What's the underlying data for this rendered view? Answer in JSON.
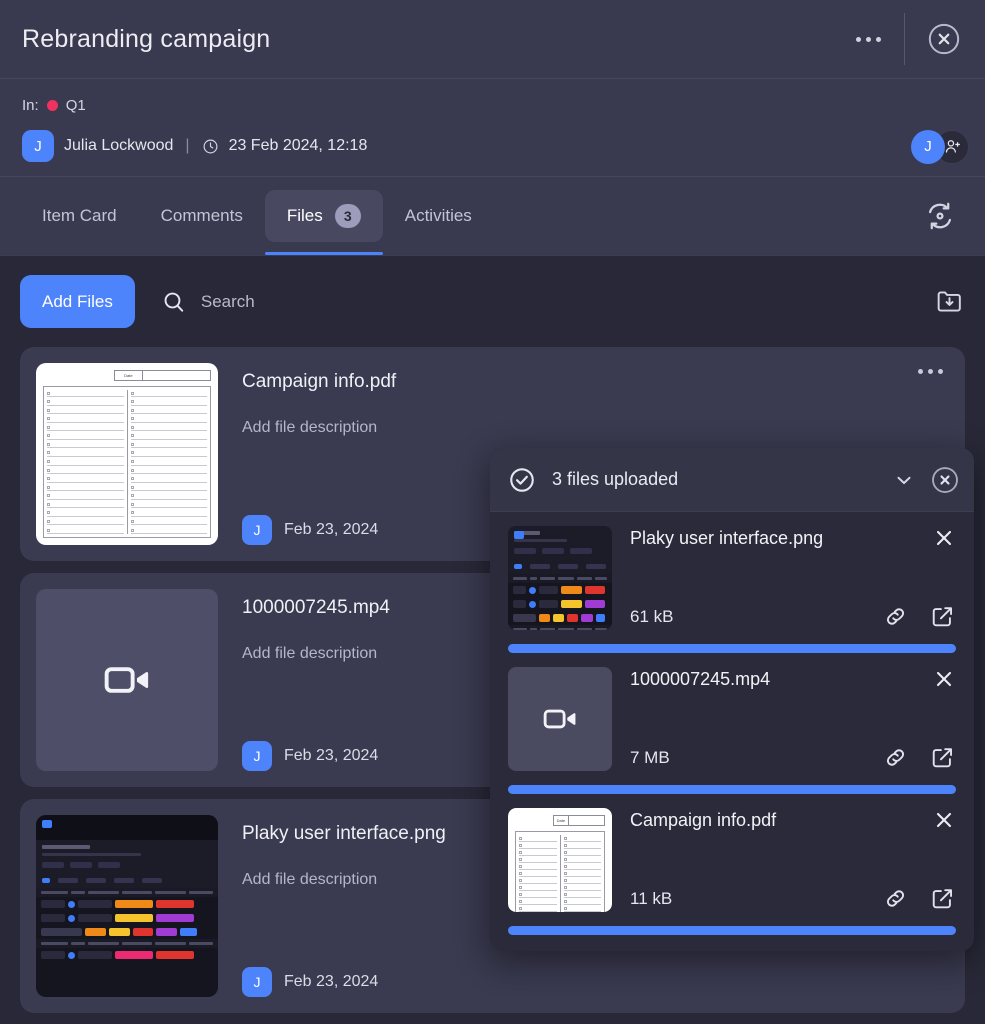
{
  "header": {
    "title": "Rebranding campaign",
    "kebab_icon": "more-horizontal-icon",
    "close_icon": "close-circle-icon"
  },
  "meta": {
    "in_label": "In:",
    "board": "Q1",
    "board_color": "#f0335e",
    "author_initial": "J",
    "author": "Julia Lockwood",
    "separator": "|",
    "clock_icon": "clock-icon",
    "datetime": "23 Feb 2024, 12:18",
    "avatar_initial": "J",
    "add_member_icon": "add-person-icon"
  },
  "tabs": [
    {
      "label": "Item Card",
      "active": false,
      "badge": null
    },
    {
      "label": "Comments",
      "active": false,
      "badge": null
    },
    {
      "label": "Files",
      "active": true,
      "badge": "3"
    },
    {
      "label": "Activities",
      "active": false,
      "badge": null
    }
  ],
  "tabbar": {
    "sync_icon": "sync-refresh-icon"
  },
  "toolbar": {
    "add_files_label": "Add Files",
    "search_icon": "search-icon",
    "search_placeholder": "Search",
    "search_value": "",
    "download_folder_icon": "folder-download-icon"
  },
  "files": [
    {
      "name": "Campaign info.pdf",
      "description": "Add file description",
      "avatar_initial": "J",
      "date": "Feb 23, 2024",
      "thumb_type": "pdf",
      "kebab_icon": "more-horizontal-icon"
    },
    {
      "name": "1000007245.mp4",
      "description": "Add file description",
      "avatar_initial": "J",
      "date": "Feb 23, 2024",
      "thumb_type": "video",
      "kebab_icon": "more-horizontal-icon"
    },
    {
      "name": "Plaky user interface.png",
      "description": "Add file description",
      "avatar_initial": "J",
      "date": "Feb 23, 2024",
      "thumb_type": "png",
      "kebab_icon": "more-horizontal-icon"
    }
  ],
  "toast": {
    "status_icon": "check-circle-icon",
    "title": "3 files uploaded",
    "collapse_icon": "chevron-down-icon",
    "close_icon": "close-circle-icon",
    "uploads": [
      {
        "name": "Plaky user interface.png",
        "size": "61 kB",
        "progress": 100,
        "thumb_type": "png",
        "remove_icon": "close-icon",
        "link_icon": "link-icon",
        "open_icon": "open-external-icon"
      },
      {
        "name": "1000007245.mp4",
        "size": "7 MB",
        "progress": 100,
        "thumb_type": "video",
        "remove_icon": "close-icon",
        "link_icon": "link-icon",
        "open_icon": "open-external-icon"
      },
      {
        "name": "Campaign info.pdf",
        "size": "11 kB",
        "progress": 100,
        "thumb_type": "pdf",
        "remove_icon": "close-icon",
        "link_icon": "link-icon",
        "open_icon": "open-external-icon"
      }
    ]
  },
  "colors": {
    "accent": "#4d84fb",
    "panel": "#393950",
    "content_bg": "#282838",
    "card_bg": "#3a3a50",
    "toast_bg": "#2a2a3a",
    "status_red": "#f0335e"
  },
  "pdf_thumb": {
    "date_label": "Date"
  }
}
